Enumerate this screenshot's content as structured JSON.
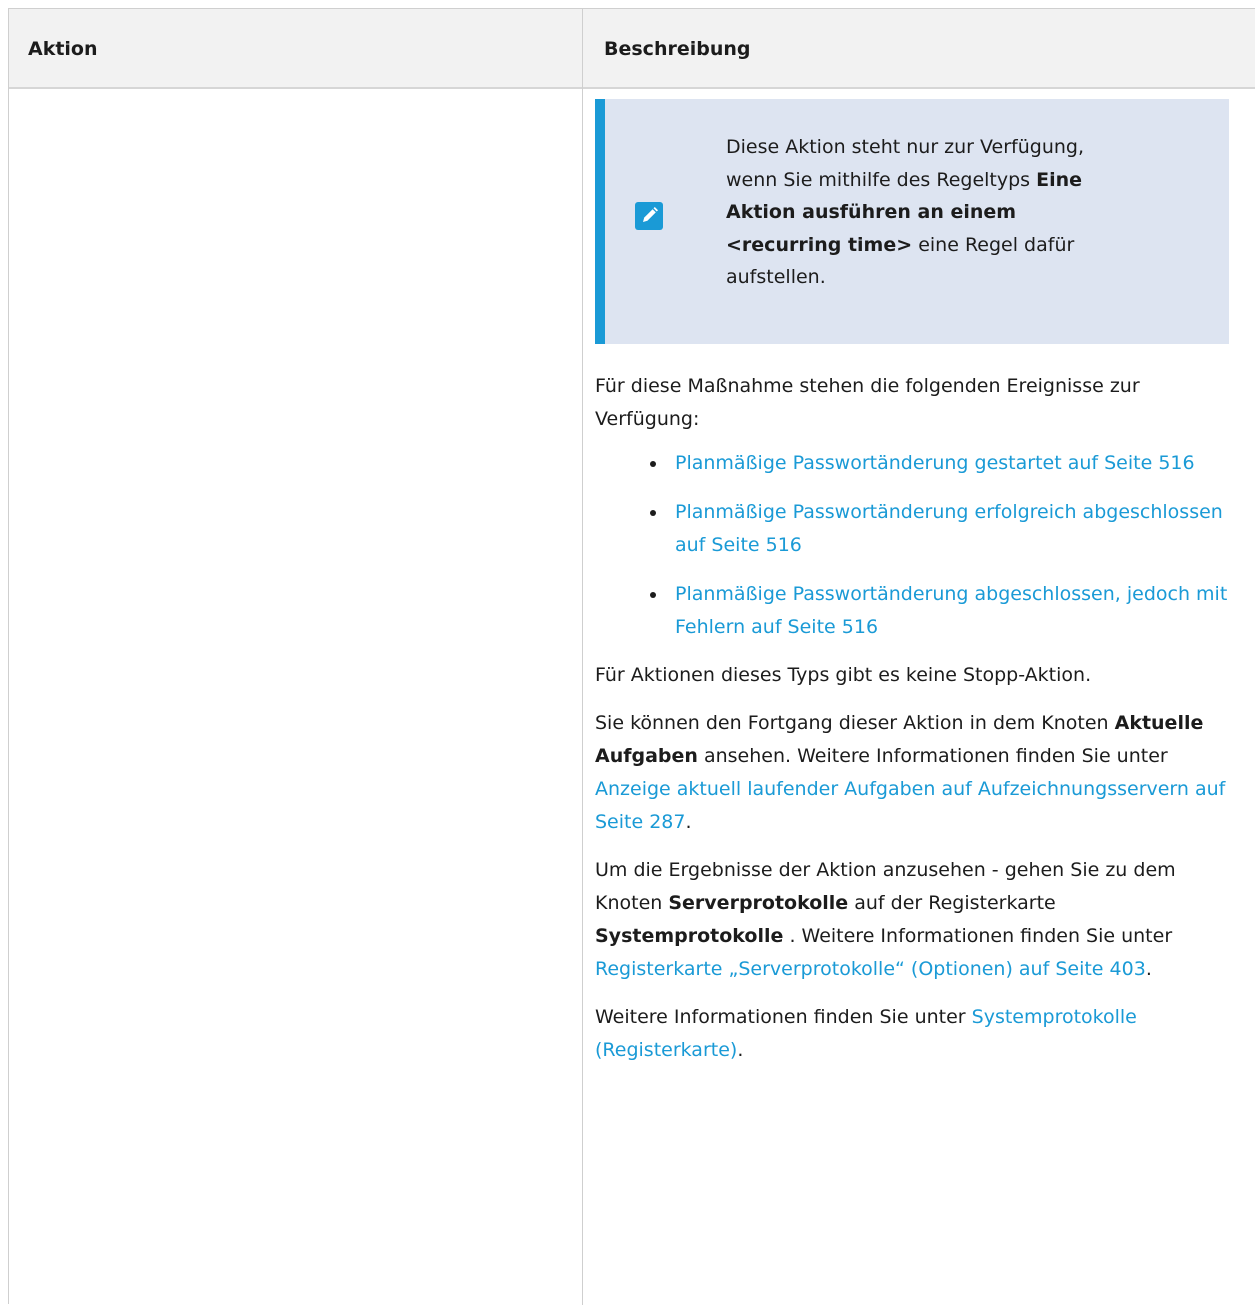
{
  "table": {
    "header_action": "Aktion",
    "header_description": "Beschreibung"
  },
  "note": {
    "icon": "pencil-icon",
    "text_1": "Diese Aktion steht nur zur Verfügung, wenn Sie mithilfe des Regeltyps ",
    "bold_1": "Eine Aktion ausführen an einem <recurring time>",
    "text_2": " eine Regel dafür aufstellen."
  },
  "intro": "Für diese Maßnahme stehen die folgenden Ereignisse zur Verfügung:",
  "events": [
    {
      "label": "Planmäßige Passwortänderung gestartet auf Seite 516"
    },
    {
      "label": "Planmäßige Passwortänderung erfolgreich abgeschlossen auf Seite 516"
    },
    {
      "label": "Planmäßige Passwortänderung abgeschlossen, jedoch mit Fehlern auf Seite 516"
    }
  ],
  "no_stop": "Für Aktionen dieses Typs gibt es keine Stopp-Aktion.",
  "progress": {
    "text_1": "Sie können den Fortgang dieser Aktion in dem Knoten ",
    "bold_1": "Aktuelle Aufgaben",
    "text_2": " ansehen. Weitere Informationen finden Sie unter ",
    "link": "Anzeige aktuell laufender Aufgaben auf Aufzeichnungsservern auf Seite 287",
    "text_3": "."
  },
  "results": {
    "text_1": "Um die Ergebnisse der Aktion anzusehen - gehen Sie zu dem Knoten ",
    "bold_1": "Serverprotokolle",
    "text_2": " auf der Registerkarte ",
    "bold_2": "Systemprotokolle",
    "text_3": " . Weitere Informationen finden Sie unter ",
    "link": "Registerkarte „Serverprotokolle“ (Optionen) auf Seite 403",
    "text_4": "."
  },
  "more": {
    "text_1": "Weitere Informationen finden Sie unter ",
    "link": "Systemprotokolle (Registerkarte)",
    "text_2": "."
  },
  "colors": {
    "accent": "#1a9ad6",
    "note_bg": "#dde4f1",
    "header_bg": "#f2f2f2"
  }
}
